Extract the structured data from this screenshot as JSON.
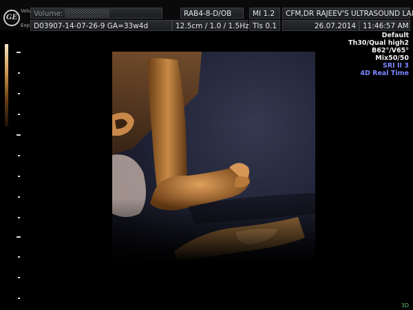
{
  "header": {
    "row1": {
      "patient": "Volume: ░░░░░░░░",
      "probe": "RAB4-8-D/OB",
      "mi": "MI  1.2",
      "clinic": "CFM,DR RAJEEV'S ULTRASOUND LAI"
    },
    "row2": {
      "id": "D03907-14-07-26-9  GA=33w4d",
      "depth": "12.5cm / 1.0 / 1.5Hz",
      "tis": "TIs  0.1",
      "date": "26.07.2014",
      "time": "11:46:57 AM"
    },
    "side_labels": {
      "s1": "Volume",
      "s2": "Exp"
    },
    "logo": "GE"
  },
  "params": {
    "p1": "Default",
    "p2": "Th30/Qual high2",
    "p3": "B62°/V65°",
    "p4": "Mix50/50",
    "p5": "SRI II 3",
    "p6": "4D Real Time"
  },
  "corner_label": "3D",
  "colors": {
    "accent_blue": "#7d86ff",
    "tissue": "#b87a3a",
    "background": "#000000"
  }
}
